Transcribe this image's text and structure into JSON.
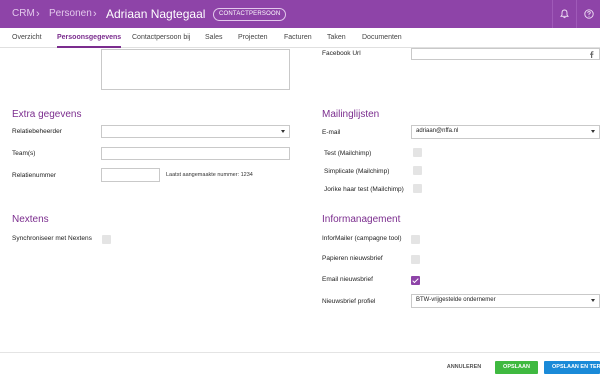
{
  "header": {
    "crumbs": [
      "CRM",
      "Personen",
      "Adriaan Nagtegaal"
    ],
    "badge": "CONTACTPERSOON",
    "icons": [
      "bell-icon",
      "help-icon"
    ]
  },
  "tabs": [
    "Overzicht",
    "Persoonsgegevens",
    "Contactpersoon bij",
    "Sales",
    "Projecten",
    "Facturen",
    "Taken",
    "Documenten"
  ],
  "active_tab": "Persoonsgegevens",
  "left": {
    "extra": {
      "title": "Extra gegevens",
      "relatiebeheerder_label": "Relatiebeheerder",
      "relatiebeheerder_value": "",
      "teams_label": "Team(s)",
      "teams_value": "",
      "relatienummer_label": "Relatienummer",
      "relatienummer_value": "",
      "last_number_hint": "Laatst aangemaakte nummer: 1234"
    },
    "nextens": {
      "title": "Nextens",
      "sync_label": "Synchroniseer met Nextens",
      "sync_checked": false
    }
  },
  "right": {
    "facebook_label": "Facebook Url",
    "facebook_value": "",
    "mailing": {
      "title": "Mailinglijsten",
      "email_label": "E-mail",
      "email_value": "adriaan@nffa.nl",
      "lists": [
        {
          "label": "Test (Mailchimp)",
          "checked": false
        },
        {
          "label": "Simplicate (Mailchimp)",
          "checked": false
        },
        {
          "label": "Jorike haar test (Mailchimp)",
          "checked": false
        }
      ]
    },
    "info": {
      "title": "Informanagement",
      "items": [
        {
          "label": "InforMailer (campagne tool)",
          "checked": false
        },
        {
          "label": "Papieren nieuwsbrief",
          "checked": false
        },
        {
          "label": "Email nieuwsbrief",
          "checked": true
        }
      ],
      "profile_label": "Nieuwsbrief profiel",
      "profile_value": "BTW-vrijgestelde ondernemer"
    }
  },
  "footer": {
    "cancel": "ANNULEREN",
    "save": "OPSLAAN",
    "save_close": "OPSLAAN EN TERUG"
  },
  "colors": {
    "brand": "#8e44a8",
    "accent": "#7b2d8e",
    "save": "#3fb940",
    "save_close": "#1a8ad8"
  }
}
